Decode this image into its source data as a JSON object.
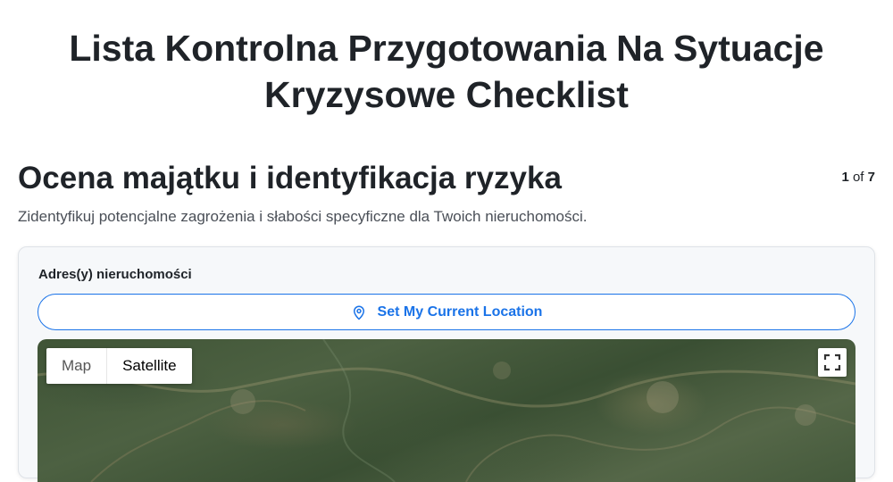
{
  "page": {
    "title": "Lista Kontrolna Przygotowania Na Sytuacje Kryzysowe Checklist"
  },
  "section": {
    "title": "Ocena majątku i identyfikacja ryzyka",
    "description": "Zidentyfikuj potencjalne zagrożenia i słabości specyficzne dla Twoich nieruchomości.",
    "step_current": "1",
    "step_of": "of",
    "step_total": "7"
  },
  "address_field": {
    "label": "Adres(y) nieruchomości",
    "location_button": "Set My Current Location",
    "location_icon": "map-pin-icon"
  },
  "map": {
    "type_options": [
      "Map",
      "Satellite"
    ],
    "selected_type": "Satellite",
    "fullscreen_icon": "fullscreen-icon"
  },
  "colors": {
    "accent": "#1a73e8",
    "text": "#1f2328",
    "card_bg": "#f6f8fa"
  }
}
